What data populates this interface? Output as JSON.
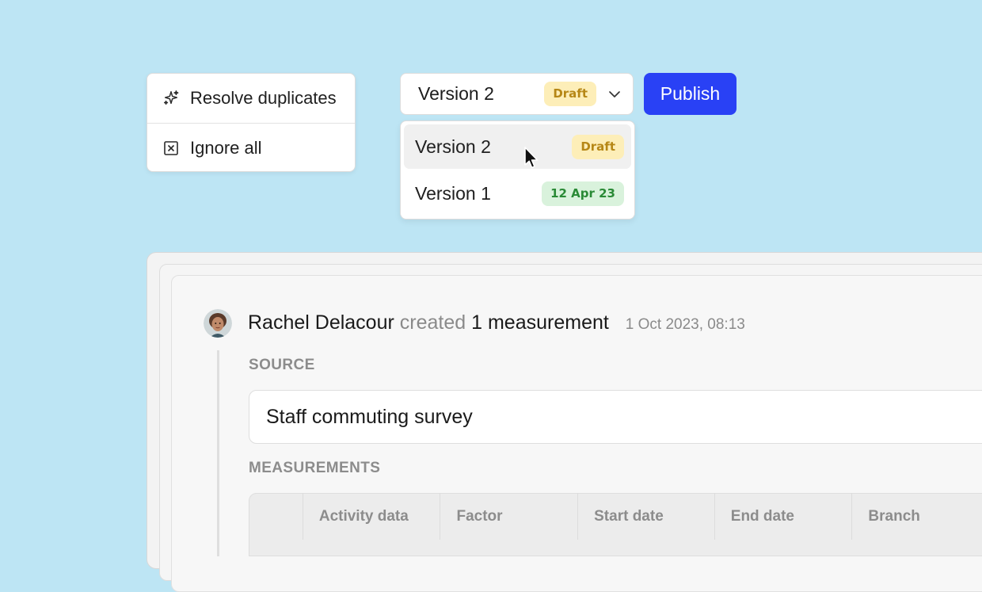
{
  "actions_menu": {
    "items": [
      {
        "label": "Resolve duplicates",
        "icon": "sparkle-icon"
      },
      {
        "label": "Ignore all",
        "icon": "x-square-icon"
      }
    ]
  },
  "version_select": {
    "selected_label": "Version 2",
    "selected_badge": "Draft",
    "icon": "chevron-down-icon"
  },
  "version_options": [
    {
      "label": "Version 2",
      "badge": "Draft",
      "hovered": true
    },
    {
      "label": "Version 1",
      "badge": "12 Apr 23",
      "hovered": false
    }
  ],
  "publish": {
    "label": "Publish"
  },
  "activity": {
    "user": "Rachel Delacour",
    "verb": "created",
    "object": "1 measurement",
    "timestamp": "1 Oct 2023, 08:13"
  },
  "source": {
    "label": "SOURCE",
    "value": "Staff commuting survey"
  },
  "measurements": {
    "label": "MEASUREMENTS",
    "columns": [
      "",
      "Activity data",
      "Factor",
      "Start date",
      "End date",
      "Branch"
    ]
  },
  "colors": {
    "background": "#bde5f4",
    "accent": "#2941f5",
    "draft_badge_bg": "#fdeeb8",
    "draft_badge_text": "#b68716",
    "date_badge_bg": "#d9f2dc",
    "date_badge_text": "#2a8a36"
  }
}
